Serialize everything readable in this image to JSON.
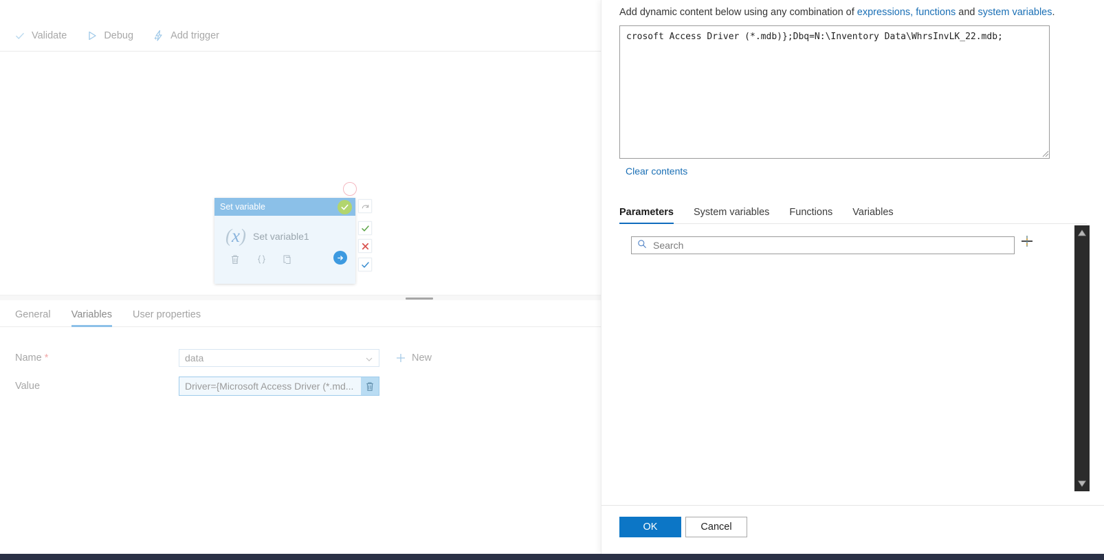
{
  "toolbar": {
    "items": [
      {
        "label": "Validate",
        "icon": "check-icon"
      },
      {
        "label": "Debug",
        "icon": "play-icon"
      },
      {
        "label": "Add trigger",
        "icon": "lightning-plus-icon"
      }
    ]
  },
  "canvas": {
    "activity": {
      "title": "Set variable",
      "name": "Set variable1",
      "type_icon": "function-x-icon",
      "status_icon": "success-check-icon",
      "footer_icons": [
        "delete-icon",
        "code-braces-icon",
        "clone-icon",
        "run-arrow-icon"
      ],
      "dependency_stubs": [
        {
          "name": "skip",
          "icon": "skip-arc-icon"
        },
        {
          "name": "success",
          "icon": "green-check-icon"
        },
        {
          "name": "failure",
          "icon": "red-x-icon"
        },
        {
          "name": "completion",
          "icon": "blue-check-icon"
        }
      ]
    }
  },
  "properties": {
    "tabs": [
      {
        "label": "General",
        "active": false
      },
      {
        "label": "Variables",
        "active": true
      },
      {
        "label": "User properties",
        "active": false
      }
    ],
    "name_field": {
      "label": "Name",
      "required_marker": "*",
      "value": "data",
      "chevron": "chevron-down-icon"
    },
    "new_button": {
      "label": "New",
      "icon": "plus-icon"
    },
    "value_field": {
      "label": "Value",
      "value": "Driver={Microsoft Access Driver (*.md...",
      "clear_icon": "trash-icon"
    }
  },
  "flyout": {
    "intro": {
      "prefix": "Add dynamic content below using any combination of ",
      "link1": "expressions, functions",
      "middle": " and ",
      "link2": "system variables",
      "suffix": "."
    },
    "expression": "crosoft Access Driver (*.mdb)};Dbq=N:\\Inventory Data\\WhrsInvLK_22.mdb;",
    "clear_contents_label": "Clear contents",
    "tabs": [
      {
        "label": "Parameters",
        "active": true
      },
      {
        "label": "System variables",
        "active": false
      },
      {
        "label": "Functions",
        "active": false
      },
      {
        "label": "Variables",
        "active": false
      }
    ],
    "search": {
      "placeholder": "Search",
      "value": "",
      "icon": "search-icon"
    },
    "add_button": {
      "icon": "plus-icon"
    },
    "scrollbar": {
      "up_icon": "triangle-up-icon",
      "down_icon": "triangle-down-icon"
    },
    "footer": {
      "ok_label": "OK",
      "cancel_label": "Cancel"
    }
  },
  "colors": {
    "accent": "#0c76c6",
    "link": "#1a6fb5",
    "tab_underline": "#0f6cbd",
    "card_header": "#8bc0e8",
    "card_body": "#eef6fc",
    "success": "#b2d56e",
    "failure": "#d9534f",
    "scrollbar_track": "#2b2b2b",
    "bottom_bar": "#2b3146"
  }
}
